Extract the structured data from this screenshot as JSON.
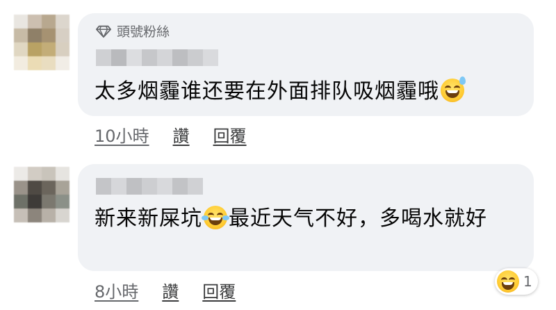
{
  "comments": [
    {
      "badge": "頭號粉絲",
      "text_before": "太多烟霾谁还要在外面排队吸烟霾哦",
      "text_after": "",
      "emoji": "grinning-sweat-icon",
      "time": "10小時",
      "like": "讚",
      "reply": "回覆"
    },
    {
      "badge": "",
      "text_before": "新来新屎坑",
      "text_after": "最近天气不好，多喝水就好",
      "emoji": "laughing-tears-icon",
      "time": "8小時",
      "like": "讚",
      "reply": "回覆",
      "reaction_count": "1",
      "reaction_icon": "laughing-squint-icon"
    }
  ],
  "colors": {
    "bubble": "#f0f2f5",
    "text": "#050505",
    "meta": "#65676b"
  }
}
